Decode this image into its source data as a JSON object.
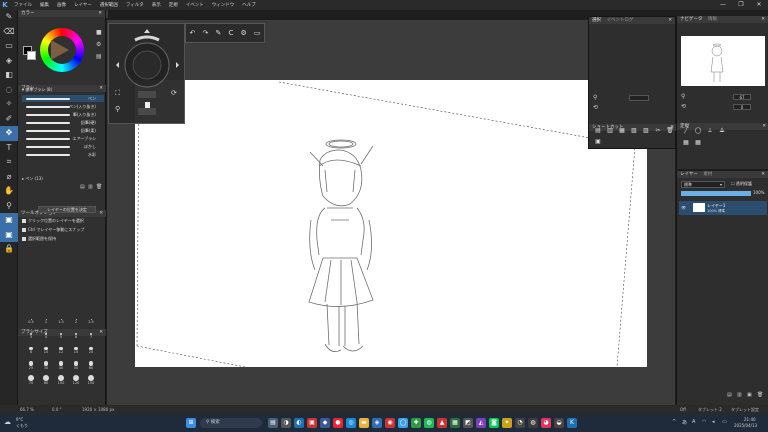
{
  "window": {
    "title": "名称未設定 1 *",
    "menus": [
      "ファイル",
      "編集",
      "画像",
      "レイヤー",
      "選択範囲",
      "フィルタ",
      "表示",
      "定規",
      "ウィンドウ",
      "ヘルプ"
    ],
    "menus_raw": [
      "ファイル",
      "編集",
      "画像",
      "レイヤー",
      "選択範囲",
      "フィルタ",
      "表示",
      "定規",
      "イベント",
      "ウィンドウ",
      "ヘルプ"
    ]
  },
  "left_panel": {
    "color_title": "カラー",
    "brush_title": "ブラシ",
    "brush_group": "標準ブラシ (8)",
    "brushes": [
      "ペン",
      "ペン(入り抜き)",
      "筆(入り抜き)",
      "鉛筆(硬)",
      "鉛筆(柔)",
      "エアーブラシ",
      "ぼかし",
      "水彩"
    ],
    "pen_group": "ペン (13)",
    "tool_option_title": "ツールオプション",
    "tool_option_button": "レイヤーの位置を決定",
    "tool_option_rows": [
      "クリック位置のレイヤーを選択",
      "Ctrl でレイヤー移動にスナップ",
      "選択範囲を保持"
    ],
    "brush_size_title": "ブラシサイズ",
    "brush_sizes": [
      "0.5",
      "1",
      "1.5",
      "2",
      "2.5",
      "3",
      "4",
      "5",
      "6",
      "7",
      "8",
      "10",
      "12",
      "15",
      "20",
      "25",
      "30",
      "40",
      "50",
      "60",
      "70",
      "80",
      "100",
      "120",
      "150"
    ]
  },
  "right_panels": {
    "tab_layer_setting": "選択",
    "tab_event": "イベントログ",
    "shortcut_title": "ショートカット",
    "navigator_title": "ナビゲータ",
    "navigator_tab2": "情報",
    "navigator_zoom": "67",
    "navigator_rotation": "0",
    "ruler_title": "定規",
    "layer_title": "レイヤー",
    "layer_tab2": "素材",
    "blend_mode": "標準",
    "protect_label": "透明保護",
    "opacity": "100%",
    "layer_name": "レイヤー1",
    "layer_info": "100% 標準"
  },
  "status": {
    "zoom": "66.7 %",
    "angle": "0.0 °",
    "size": "1920 × 1080 px",
    "right1": "Off",
    "right2": "タブレット 2",
    "right3": "タブレット設定"
  },
  "taskbar": {
    "weather_temp": "9°C",
    "weather_desc": "くもり",
    "search_placeholder": "検索",
    "time": "21:40",
    "date": "2025/04/13",
    "lang1": "あ",
    "lang2": "A"
  },
  "colors": {
    "accent": "#3b6fa8",
    "panel": "#303030",
    "canvas_bg": "#3c3c3c",
    "paper": "#ffffff"
  }
}
